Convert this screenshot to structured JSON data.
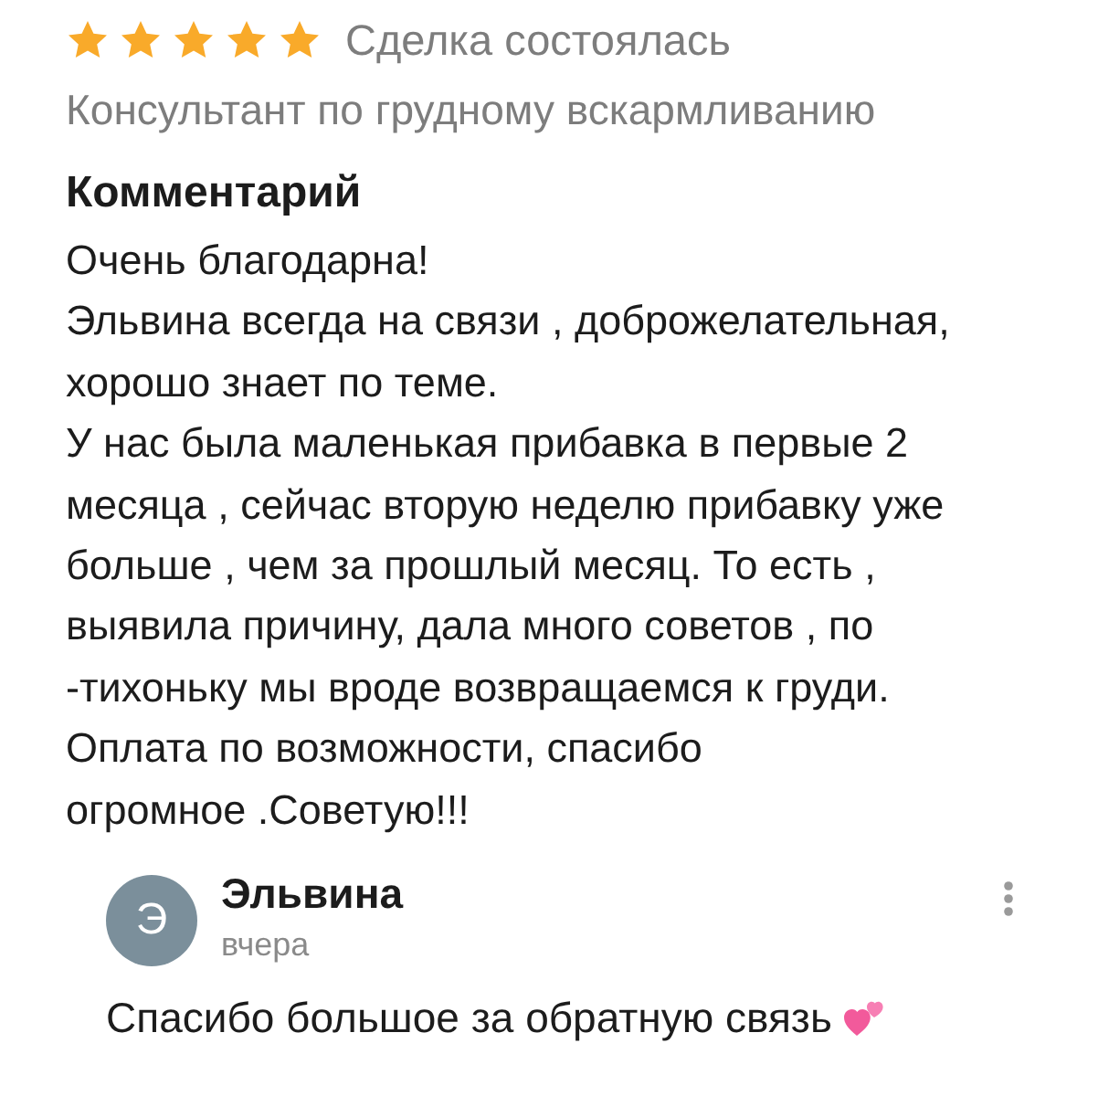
{
  "review": {
    "stars": 5,
    "status": "Сделка состоялась",
    "service": "Консультант по грудному вскармливанию"
  },
  "comment": {
    "heading": "Комментарий",
    "text": "Очень благодарна!\nЭльвина всегда на связи , доброжелательная,\nхорошо знает по теме.\nУ нас была маленькая прибавка в первые 2\nмесяца , сейчас вторую неделю прибавку уже\nбольше , чем за прошлый месяц. То есть ,\nвыявила причину, дала много советов , по\n-тихоньку мы вроде возвращаемся к груди.\nОплата по возможности, спасибо\nогромное .Советую!!!"
  },
  "reply": {
    "avatar_letter": "Э",
    "author": "Эльвина",
    "time": "вчера",
    "text": "Спасибо большое за обратную связь"
  }
}
